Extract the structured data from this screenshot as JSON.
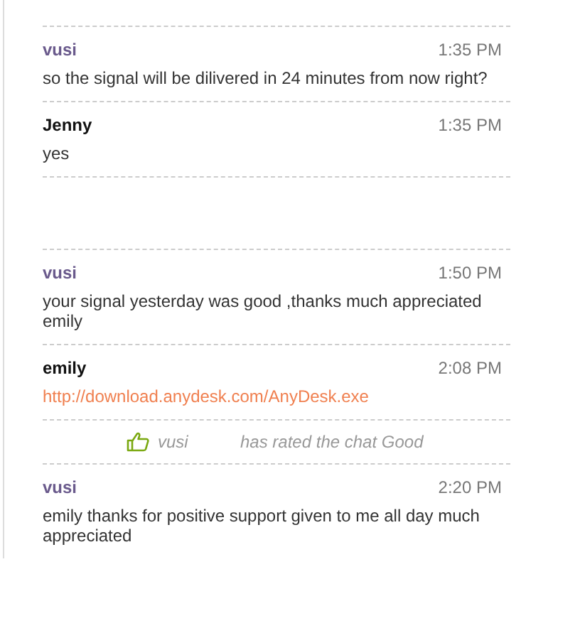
{
  "messages": [
    {
      "kind": "visitor",
      "name": "vusi",
      "time": "1:35 PM",
      "body": "so the signal will be dilivered in 24 minutes from now right?"
    },
    {
      "kind": "agent",
      "name": "Jenny",
      "time": "1:35 PM",
      "body": "yes"
    },
    {
      "kind": "gap"
    },
    {
      "kind": "visitor",
      "name": "vusi",
      "time": "1:50 PM",
      "body": "your signal yesterday was good ,thanks much appreciated emily"
    },
    {
      "kind": "agent_link",
      "name": "emily",
      "time": "2:08 PM",
      "body": "http://download.anydesk.com/AnyDesk.exe"
    },
    {
      "kind": "rating",
      "name": "vusi",
      "text": "has rated the chat Good"
    },
    {
      "kind": "visitor",
      "name": "vusi",
      "time": "2:20 PM",
      "body": "emily thanks for positive support given to me all day much appreciated"
    }
  ]
}
